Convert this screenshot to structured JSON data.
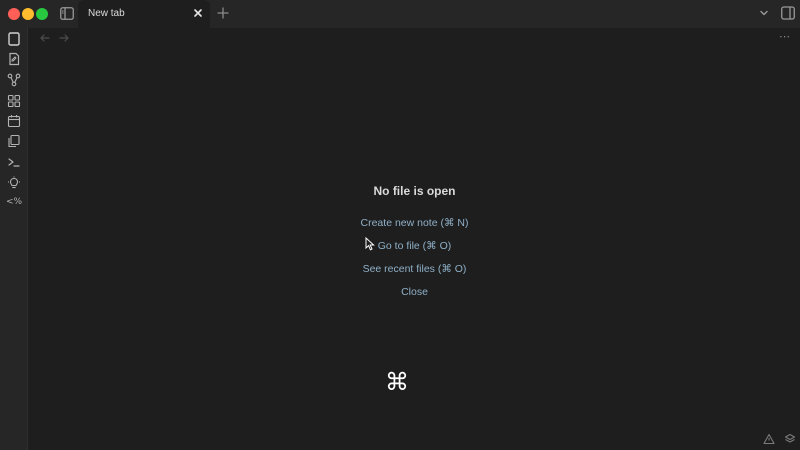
{
  "window": {
    "tab": {
      "label": "New tab"
    }
  },
  "ribbon": {
    "icons": [
      "open-switcher-icon",
      "new-note-icon",
      "graph-view-icon",
      "canvas-icon",
      "daily-note-icon",
      "templates-icon",
      "command-palette-icon",
      "slides-icon"
    ],
    "templater_label": "<%"
  },
  "content": {
    "more_label": "⋯"
  },
  "empty_state": {
    "title": "No file is open",
    "actions": [
      {
        "label": "Create new note (⌘ N)"
      },
      {
        "label": "Go to file (⌘ O)"
      },
      {
        "label": "See recent files (⌘ O)"
      },
      {
        "label": "Close"
      }
    ]
  },
  "overlay": {
    "key_glyph": "⌘"
  },
  "colors": {
    "background": "#1e1e1e",
    "chrome": "#262626",
    "link": "#8fb0c8",
    "traffic_close": "#ff5f57",
    "traffic_min": "#febc2e",
    "traffic_max": "#28c840"
  }
}
